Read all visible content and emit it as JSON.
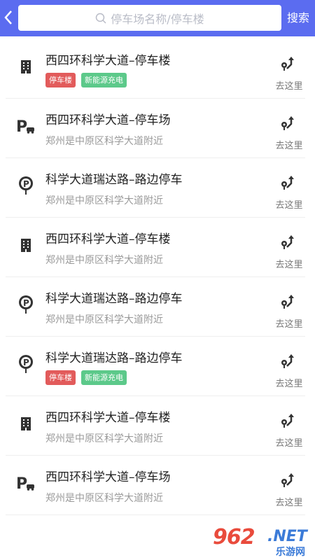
{
  "header": {
    "search_placeholder": "停车场名称/停车楼",
    "search_button": "搜索",
    "accent": "#5b6cf0"
  },
  "list": [
    {
      "type_icon": "building-icon",
      "title": "西四环科学大道–停车楼",
      "tags": [
        "停车楼",
        "新能源充电"
      ],
      "address": ""
    },
    {
      "type_icon": "parking-lot-icon",
      "title": "西四环科学大道–停车场",
      "tags": [],
      "address": "郑州是中原区科学大道附近"
    },
    {
      "type_icon": "roadside-parking-icon",
      "title": "科学大道瑞达路–路边停车",
      "tags": [],
      "address": "郑州是中原区科学大道附近"
    },
    {
      "type_icon": "building-icon",
      "title": "西四环科学大道–停车楼",
      "tags": [],
      "address": "郑州是中原区科学大道附近"
    },
    {
      "type_icon": "roadside-parking-icon",
      "title": "科学大道瑞达路–路边停车",
      "tags": [],
      "address": "郑州是中原区科学大道附近"
    },
    {
      "type_icon": "roadside-parking-icon",
      "title": "科学大道瑞达路–路边停车",
      "tags": [
        "停车楼",
        "新能源充电"
      ],
      "address": ""
    },
    {
      "type_icon": "building-icon",
      "title": "西四环科学大道–停车楼",
      "tags": [],
      "address": "郑州是中原区科学大道附近"
    },
    {
      "type_icon": "parking-lot-icon",
      "title": "西四环科学大道–停车场",
      "tags": [],
      "address": "郑州是中原区科学大道附近"
    }
  ],
  "go_label": "去这里",
  "watermark": {
    "number": "962",
    "net": ".NET",
    "cn": "乐游网"
  }
}
